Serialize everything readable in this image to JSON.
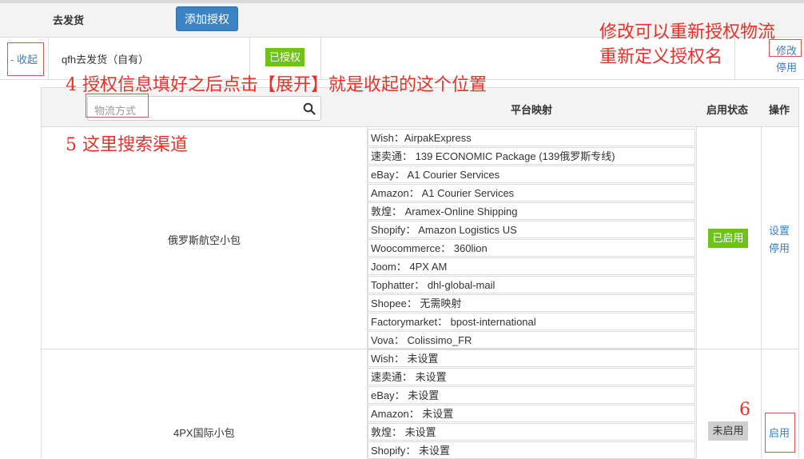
{
  "header": {
    "title": "去发货",
    "add_button": "添加授权"
  },
  "auth_row": {
    "collapse_label": "- 收起",
    "name": "qfh去发货（自有）",
    "status": "已授权",
    "edit_label": "修改",
    "disable_label": "停用"
  },
  "annotations": {
    "edit_note_line1": "修改可以重新授权物流",
    "edit_note_line2": "重新定义授权名",
    "step4": "4  授权信息填好之后点击【展开】就是收起的这个位置",
    "step5": "5  这里搜索渠道",
    "step6": "6"
  },
  "table": {
    "search_placeholder": "物流方式",
    "col_mapping": "平台映射",
    "col_status": "启用状态",
    "col_action": "操作"
  },
  "channels": [
    {
      "name": "俄罗斯航空小包",
      "status": "已启用",
      "actions": [
        "设置",
        "停用"
      ],
      "mappings": [
        "Wish：AirpakExpress",
        "速卖通： 139 ECONOMIC Package (139俄罗斯专线)",
        "eBay： A1 Courier Services",
        "Amazon： A1 Courier Services",
        "敦煌： Aramex-Online Shipping",
        "Shopify： Amazon Logistics US",
        "Woocommerce： 360lion",
        "Joom： 4PX AM",
        "Tophatter： dhl-global-mail",
        "Shopee： 无需映射",
        "Factorymarket： bpost-international",
        "Vova： Colissimo_FR"
      ]
    },
    {
      "name": "4PX国际小包",
      "status": "未启用",
      "actions": [
        "启用"
      ],
      "mappings": [
        "Wish： 未设置",
        "速卖通： 未设置",
        "eBay： 未设置",
        "Amazon： 未设置",
        "敦煌： 未设置",
        "Shopify： 未设置"
      ]
    }
  ],
  "colors": {
    "primary": "#3a83c4",
    "success": "#6ec21a",
    "annotation": "#e8312a",
    "link": "#3a7fc1"
  }
}
